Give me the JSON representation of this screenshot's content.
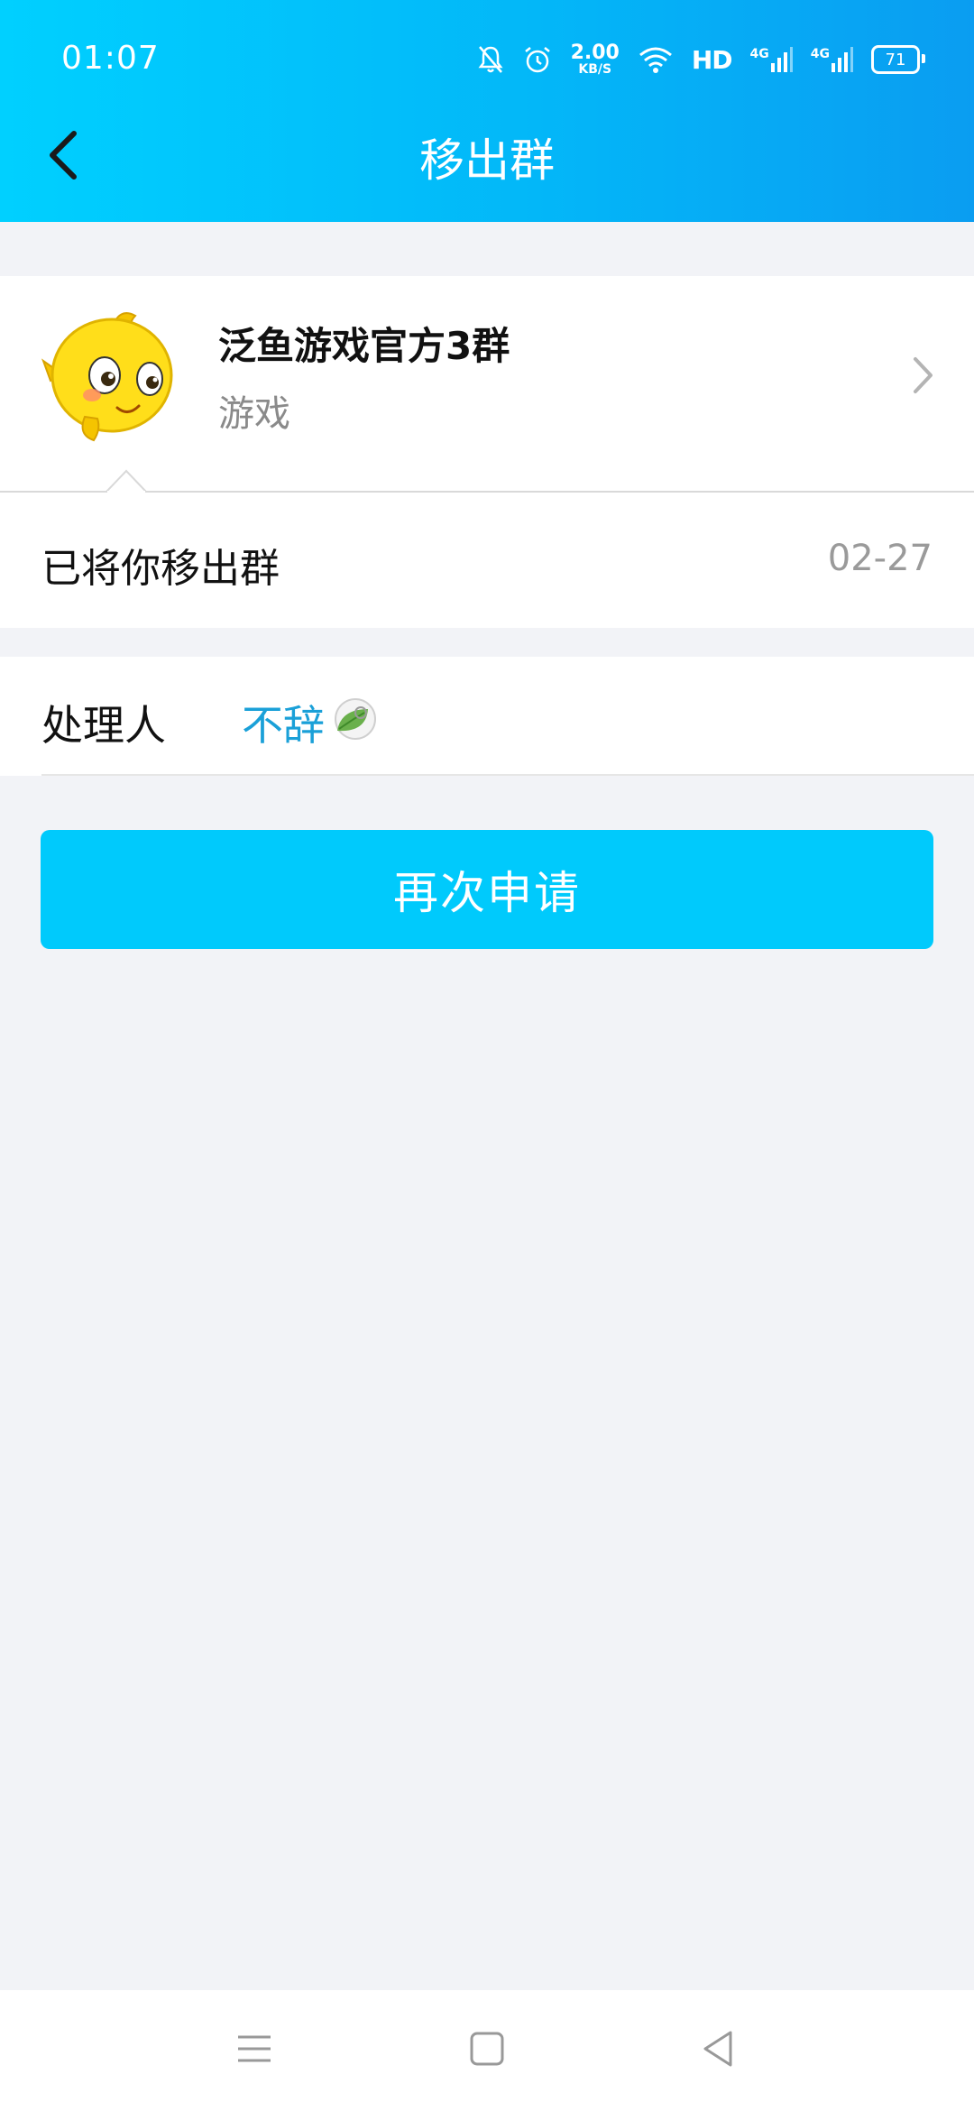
{
  "status_bar": {
    "time": "01:07",
    "net_speed_value": "2.00",
    "net_speed_unit": "KB/S",
    "hd_label": "HD",
    "signal_1": "4G",
    "signal_2": "4G",
    "battery": "71",
    "icons": [
      "mute-bell-icon",
      "alarm-icon",
      "wifi-icon",
      "hd-icon",
      "signal-icon",
      "battery-icon"
    ]
  },
  "header": {
    "title": "移出群",
    "back_icon": "chevron-left-icon"
  },
  "group": {
    "name": "泛鱼游戏官方3群",
    "category": "游戏",
    "avatar_icon": "yellow-fish-avatar",
    "chevron_icon": "chevron-right-icon"
  },
  "message": {
    "text": "已将你移出群",
    "date": "02-27"
  },
  "handler": {
    "label": "处理人",
    "name": "不辞",
    "badge_icon": "leaf-icon"
  },
  "actions": {
    "reapply_label": "再次申请"
  },
  "nav_bar": {
    "icons": [
      "menu-icon",
      "home-icon",
      "back-icon"
    ]
  },
  "colors": {
    "header_gradient_start": "#00d0ff",
    "header_gradient_end": "#0a9df1",
    "button": "#00cafc",
    "handler_link": "#1aa0d8",
    "background": "#f2f3f7"
  }
}
